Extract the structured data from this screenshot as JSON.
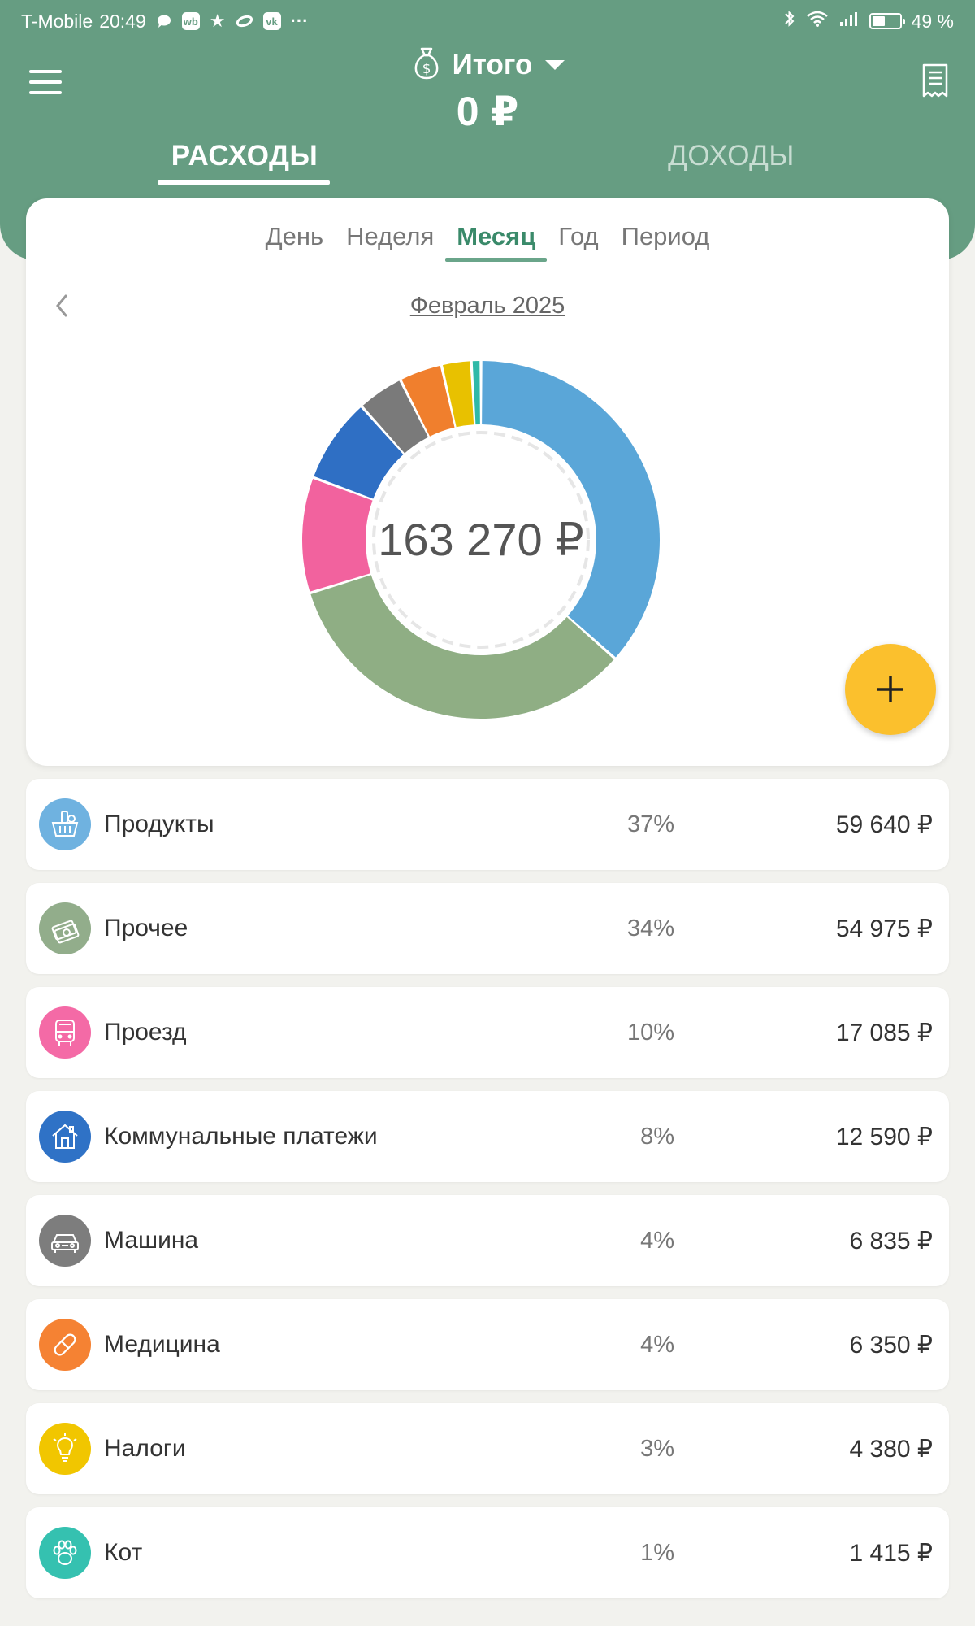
{
  "status_bar": {
    "carrier": "T-Mobile",
    "time": "20:49",
    "wb_badge": "wb",
    "vk_badge": "vk",
    "more": "···",
    "battery_percent": "49 %",
    "battery_level": 0.49
  },
  "header": {
    "account_title": "Итого",
    "balance": "0 ₽",
    "tabs": [
      {
        "label": "РАСХОДЫ",
        "active": true
      },
      {
        "label": "ДОХОДЫ",
        "active": false
      }
    ]
  },
  "chart_card": {
    "period_tabs": [
      {
        "label": "День",
        "active": false
      },
      {
        "label": "Неделя",
        "active": false
      },
      {
        "label": "Месяц",
        "active": true
      },
      {
        "label": "Год",
        "active": false
      },
      {
        "label": "Период",
        "active": false
      }
    ],
    "month_label": "Февраль 2025",
    "total": "163 270 ₽"
  },
  "chart_data": {
    "type": "pie",
    "categories": [
      "Продукты",
      "Прочее",
      "Проезд",
      "Коммунальные платежи",
      "Машина",
      "Медицина",
      "Налоги",
      "Кот"
    ],
    "values": [
      59640,
      54975,
      17085,
      12590,
      6835,
      6350,
      4380,
      1415
    ],
    "colors": [
      "#5aa6d8",
      "#8fae84",
      "#f2629e",
      "#2f6fc4",
      "#7a7a7a",
      "#f07f2d",
      "#e8c100",
      "#2fb9a8"
    ]
  },
  "categories": [
    {
      "name": "Продукты",
      "percent": "37%",
      "amount": "59 640 ₽",
      "color": "#6fb2e0",
      "icon": "basket-icon"
    },
    {
      "name": "Прочее",
      "percent": "34%",
      "amount": "54 975 ₽",
      "color": "#92ad8b",
      "icon": "money-icon"
    },
    {
      "name": "Проезд",
      "percent": "10%",
      "amount": "17 085 ₽",
      "color": "#f46aa6",
      "icon": "bus-icon"
    },
    {
      "name": "Коммунальные платежи",
      "percent": "8%",
      "amount": "12 590 ₽",
      "color": "#2f72c6",
      "icon": "house-icon"
    },
    {
      "name": "Машина",
      "percent": "4%",
      "amount": "6 835 ₽",
      "color": "#7d7d7d",
      "icon": "car-icon"
    },
    {
      "name": "Медицина",
      "percent": "4%",
      "amount": "6 350 ₽",
      "color": "#f58233",
      "icon": "pill-icon"
    },
    {
      "name": "Налоги",
      "percent": "3%",
      "amount": "4 380 ₽",
      "color": "#f1c600",
      "icon": "lightbulb-icon"
    },
    {
      "name": "Кот",
      "percent": "1%",
      "amount": "1 415 ₽",
      "color": "#35c1b0",
      "icon": "paw-icon"
    }
  ]
}
